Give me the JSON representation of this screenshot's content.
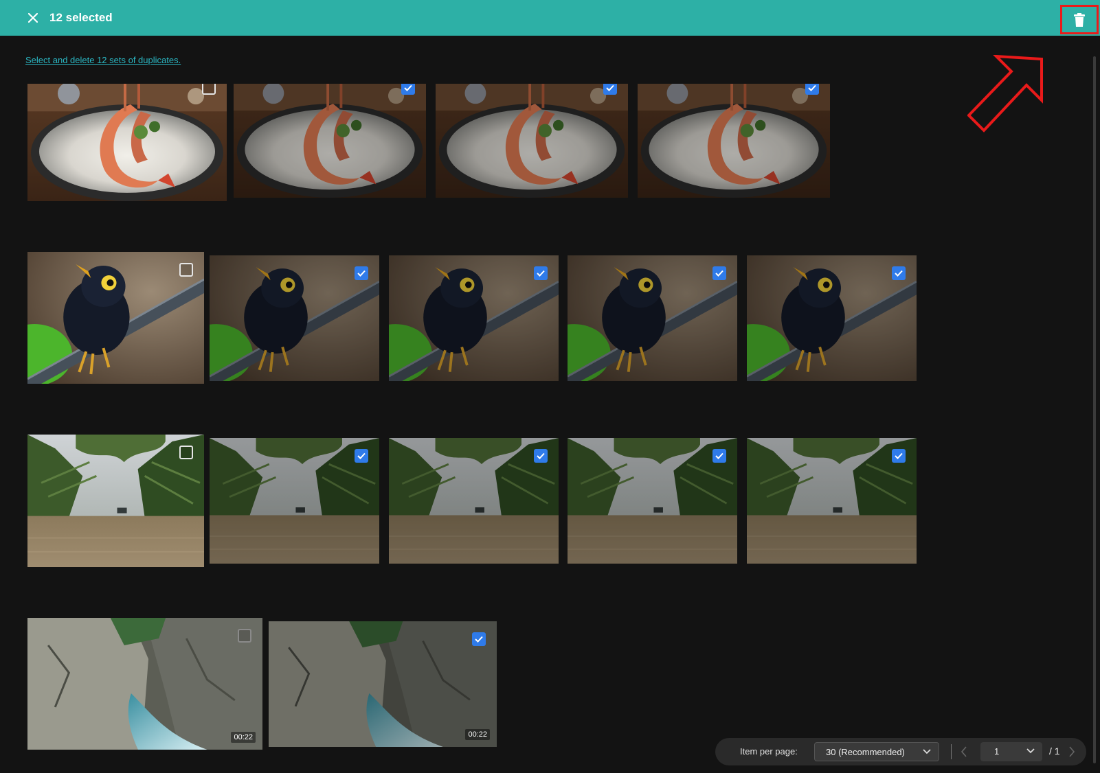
{
  "header": {
    "close_icon": "close-icon",
    "selected_label": "12 selected",
    "delete_icon": "trash-icon"
  },
  "hint_link": "Select and delete 12 sets of duplicates.",
  "groups": [
    {
      "name": "shrimp",
      "items": [
        {
          "checked": false
        },
        {
          "checked": true
        },
        {
          "checked": true
        },
        {
          "checked": true
        }
      ]
    },
    {
      "name": "bird",
      "items": [
        {
          "checked": false
        },
        {
          "checked": true
        },
        {
          "checked": true
        },
        {
          "checked": true
        },
        {
          "checked": true
        }
      ]
    },
    {
      "name": "river",
      "items": [
        {
          "checked": false
        },
        {
          "checked": true
        },
        {
          "checked": true
        },
        {
          "checked": true
        },
        {
          "checked": true
        }
      ]
    },
    {
      "name": "waterfall-video",
      "items": [
        {
          "checked": false,
          "duration": "00:22"
        },
        {
          "checked": true,
          "duration": "00:22"
        }
      ]
    }
  ],
  "pagination": {
    "items_per_page_label": "Item per page:",
    "items_per_page_value": "30 (Recommended)",
    "current_page": "1",
    "total_pages": "/ 1"
  },
  "colors": {
    "header_bg": "#2db0a6",
    "accent_link": "#2bb8c4",
    "checkbox_checked": "#2f7bea",
    "highlight_red": "#ea1a1a"
  }
}
